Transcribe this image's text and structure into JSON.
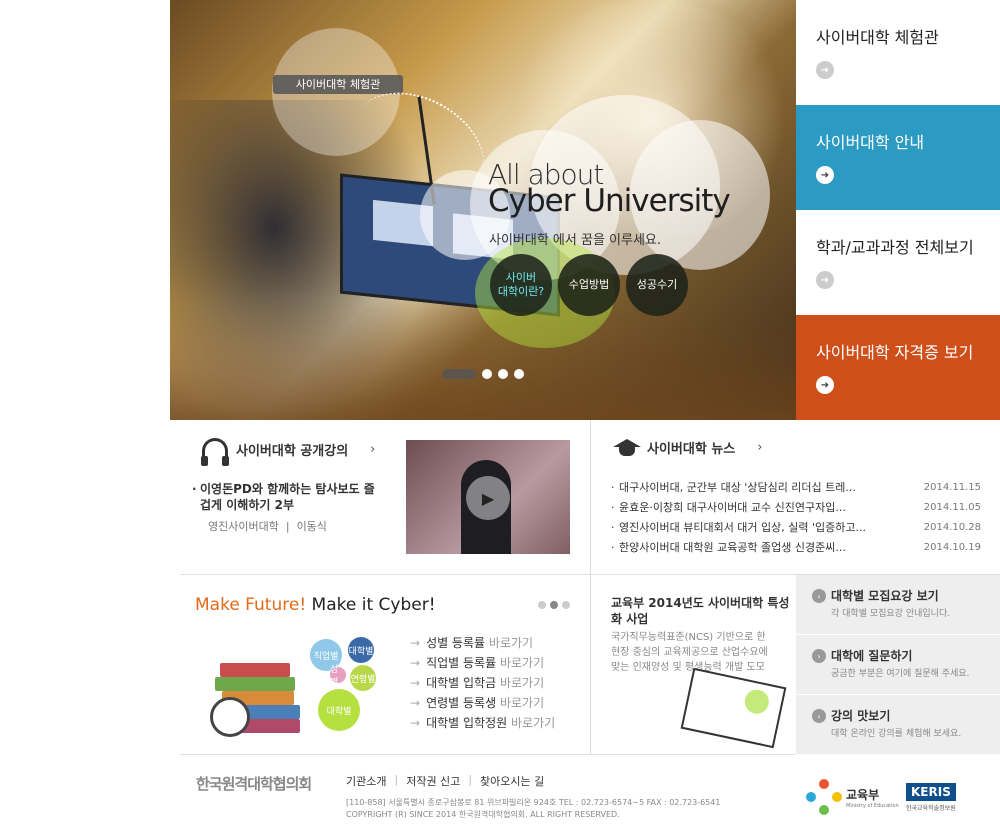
{
  "hero": {
    "tag": "사이버대학 체험관",
    "headline_line1": "All about",
    "headline_line2": "Cyber University",
    "subtitle": "사이버대학 에서 꿈을 이루세요.",
    "circles": [
      "사이버\n대학이란?",
      "수업방법",
      "성공수기"
    ]
  },
  "right_menu": [
    {
      "label": "사이버대학 체험관",
      "bg": "#ffffff"
    },
    {
      "label": "사이버대학 안내",
      "bg": "#2c9bc4"
    },
    {
      "label": "학과/교과과정 전체보기",
      "bg": "#ffffff"
    },
    {
      "label": "사이버대학 자격증 보기",
      "bg": "#cf4f1b"
    }
  ],
  "lecture": {
    "heading": "사이버대학 공개강의",
    "title": "이영돈PD와 함께하는 탐사보도 즐겁게 이해하기 2부",
    "school": "영진사이버대학",
    "divider": "|",
    "professor": "이동식"
  },
  "news": {
    "heading": "사이버대학 뉴스",
    "items": [
      {
        "title": "대구사이버대, 군간부 대상 '상담심리 리더십 트레...",
        "date": "2014.11.15"
      },
      {
        "title": "윤효운·이창희 대구사이버대 교수 신진연구자입...",
        "date": "2014.11.05"
      },
      {
        "title": "영진사이버대 뷰티대회서 대거 입상, 실력 '입증하고...",
        "date": "2014.10.28"
      },
      {
        "title": "한양사이버대 대학원 교육공학 졸업생 신경준씨...",
        "date": "2014.10.19"
      }
    ]
  },
  "future": {
    "title_orange": "Make Future!",
    "title_dark": " Make it Cyber!",
    "bubbles": [
      "직업별",
      "대학별",
      "성별",
      "연령별",
      "대학별"
    ],
    "links": [
      {
        "label": "성별 등록률",
        "go": "바로가기"
      },
      {
        "label": "직업별 등록률",
        "go": "바로가기"
      },
      {
        "label": "대학별 입학금",
        "go": "바로가기"
      },
      {
        "label": "연령별 등록생",
        "go": "바로가기"
      },
      {
        "label": "대학별 입학정원",
        "go": "바로가기"
      }
    ]
  },
  "ministry": {
    "title": "교육부 2014년도 사이버대학 특성화 사업",
    "desc": "국가직무능력표준(NCS) 기반으로 한 현장 중심의 교육제공으로 산업수요에 맞는 인재양성 및 평생능력 개발 도모"
  },
  "quick_links": [
    {
      "label": "대학별 모집요강 보기",
      "sub": "각 대학별 모집요강 안내입니다."
    },
    {
      "label": "대학에 질문하기",
      "sub": "궁금한 부분은 여기에 질문해 주세요."
    },
    {
      "label": "강의 맛보기",
      "sub": "대학 온라인 강의를 체험해 보세요."
    }
  ],
  "footer": {
    "org": "한국원격대학협의회",
    "links": [
      "기관소개",
      "저작권 신고",
      "찾아오시는 길"
    ],
    "address": "[110-858]   서울특별시 종로구삼봉로 81 위브파빌리온 924호    TEL : 02.723-6574~5    FAX : 02.723-6541",
    "copyright": "COPYRIGHT (R) SINCE 2014 한국원격대학협의회.  ALL RIGHT RESERVED.",
    "moe": "교육부",
    "moe_sub": "Ministry of Education",
    "keris": "KERIS",
    "keris_sub": "한국교육학술정보원"
  }
}
